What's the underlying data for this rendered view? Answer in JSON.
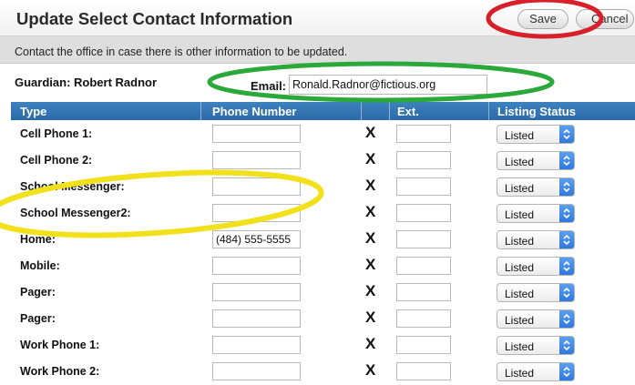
{
  "dialog": {
    "title": "Update Select Contact Information",
    "save_label": "Save",
    "cancel_label": "Cancel",
    "notice": "Contact the office in case there is other information to be updated."
  },
  "guardian": {
    "label": "Guardian: Robert Radnor",
    "email_label": "Email:",
    "email_value": "Ronald.Radnor@fictious.org"
  },
  "table": {
    "headers": {
      "type": "Type",
      "phone": "Phone Number",
      "ext": "Ext.",
      "status": "Listing Status"
    },
    "delete_glyph": "X",
    "rows": [
      {
        "type": "Cell Phone 1:",
        "phone": "",
        "ext": "",
        "status": "Listed"
      },
      {
        "type": "Cell Phone 2:",
        "phone": "",
        "ext": "",
        "status": "Listed"
      },
      {
        "type": "School Messenger:",
        "phone": "",
        "ext": "",
        "status": "Listed"
      },
      {
        "type": "School Messenger2:",
        "phone": "",
        "ext": "",
        "status": "Listed"
      },
      {
        "type": "Home:",
        "phone": "(484) 555-5555",
        "ext": "",
        "status": "Listed"
      },
      {
        "type": "Mobile:",
        "phone": "",
        "ext": "",
        "status": "Listed"
      },
      {
        "type": "Pager:",
        "phone": "",
        "ext": "",
        "status": "Listed"
      },
      {
        "type": "Pager:",
        "phone": "",
        "ext": "",
        "status": "Listed"
      },
      {
        "type": "Work Phone 1:",
        "phone": "",
        "ext": "",
        "status": "Listed"
      },
      {
        "type": "Work Phone 2:",
        "phone": "",
        "ext": "",
        "status": "Listed"
      }
    ]
  },
  "annotations": {
    "red_color": "#d8202a",
    "green_color": "#2aa83a",
    "yellow_color": "#f2e01a"
  }
}
